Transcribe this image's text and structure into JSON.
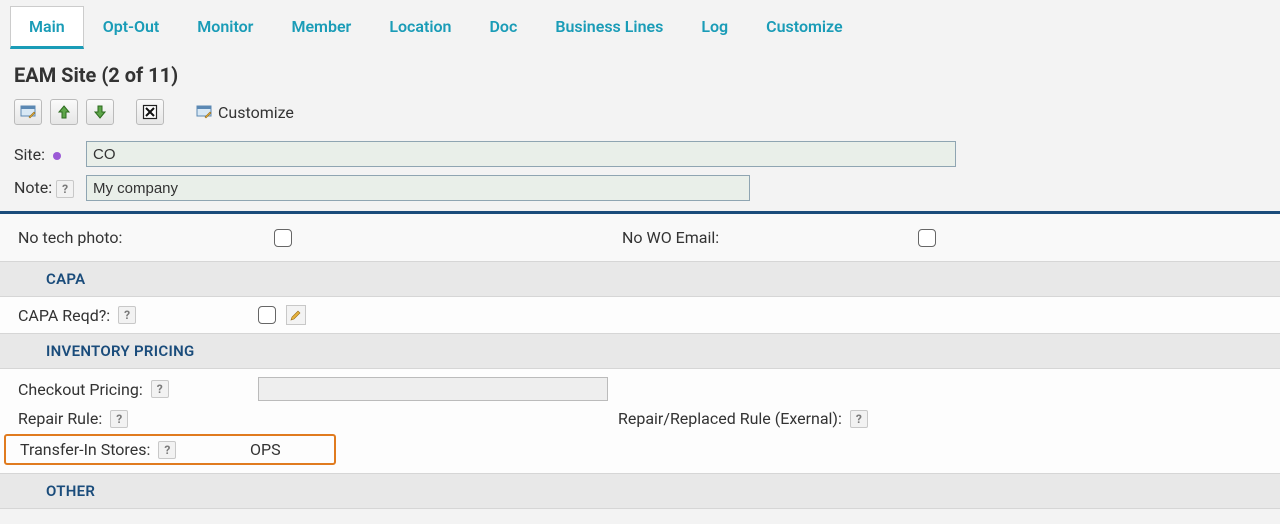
{
  "tabs": [
    {
      "label": "Main",
      "active": true
    },
    {
      "label": "Opt-Out",
      "active": false
    },
    {
      "label": "Monitor",
      "active": false
    },
    {
      "label": "Member",
      "active": false
    },
    {
      "label": "Location",
      "active": false
    },
    {
      "label": "Doc",
      "active": false
    },
    {
      "label": "Business Lines",
      "active": false
    },
    {
      "label": "Log",
      "active": false
    },
    {
      "label": "Customize",
      "active": false
    }
  ],
  "page_title": "EAM Site (2 of 11)",
  "toolbar": {
    "customize_label": "Customize"
  },
  "form": {
    "site_label": "Site:",
    "site_value": "CO",
    "note_label": "Note:",
    "note_value": "My company"
  },
  "checks": {
    "no_tech_photo_label": "No tech photo:",
    "no_wo_email_label": "No WO Email:"
  },
  "sections": {
    "capa": {
      "header": "CAPA",
      "reqd_label": "CAPA Reqd?:"
    },
    "inventory": {
      "header": "INVENTORY PRICING",
      "checkout_pricing_label": "Checkout Pricing:",
      "repair_rule_label": "Repair Rule:",
      "repair_replaced_rule_label": "Repair/Replaced Rule (Exernal):",
      "transfer_in_stores_label": "Transfer-In Stores:",
      "transfer_in_stores_value": "OPS"
    },
    "other": {
      "header": "OTHER"
    }
  },
  "colors": {
    "accent_teal": "#1a9cb7",
    "section_blue": "#1a4c7b",
    "highlight_orange": "#e07b1f"
  }
}
